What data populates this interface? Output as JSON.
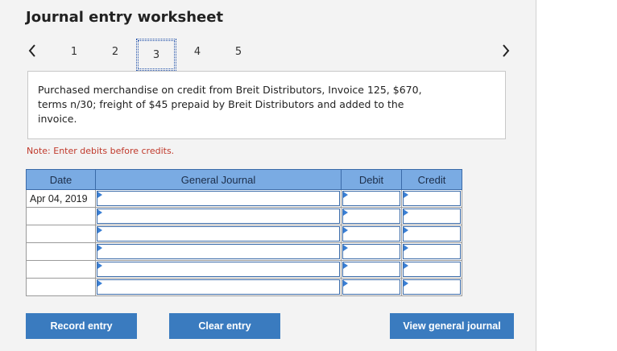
{
  "title": "Journal entry worksheet",
  "pager": {
    "pages": [
      "1",
      "2",
      "3",
      "4",
      "5"
    ],
    "active": "3"
  },
  "description": "Purchased merchandise on credit from Breit Distributors, Invoice 125, $670,\n terms n/30; freight of $45 prepaid by Breit Distributors and added to the\ninvoice.",
  "note": "Note: Enter debits before credits.",
  "table": {
    "headers": {
      "date": "Date",
      "journal": "General Journal",
      "debit": "Debit",
      "credit": "Credit"
    },
    "rows": [
      {
        "date": "Apr 04, 2019",
        "journal": "",
        "debit": "",
        "credit": ""
      },
      {
        "date": "",
        "journal": "",
        "debit": "",
        "credit": ""
      },
      {
        "date": "",
        "journal": "",
        "debit": "",
        "credit": ""
      },
      {
        "date": "",
        "journal": "",
        "debit": "",
        "credit": ""
      },
      {
        "date": "",
        "journal": "",
        "debit": "",
        "credit": ""
      },
      {
        "date": "",
        "journal": "",
        "debit": "",
        "credit": ""
      }
    ]
  },
  "buttons": {
    "record": "Record entry",
    "clear": "Clear entry",
    "view": "View general journal"
  },
  "icons": {
    "prev": "chevron-left-icon",
    "next": "chevron-right-icon"
  },
  "colors": {
    "header_bg": "#7aabe3",
    "button_bg": "#3a7bbf",
    "note": "#c0392b"
  }
}
